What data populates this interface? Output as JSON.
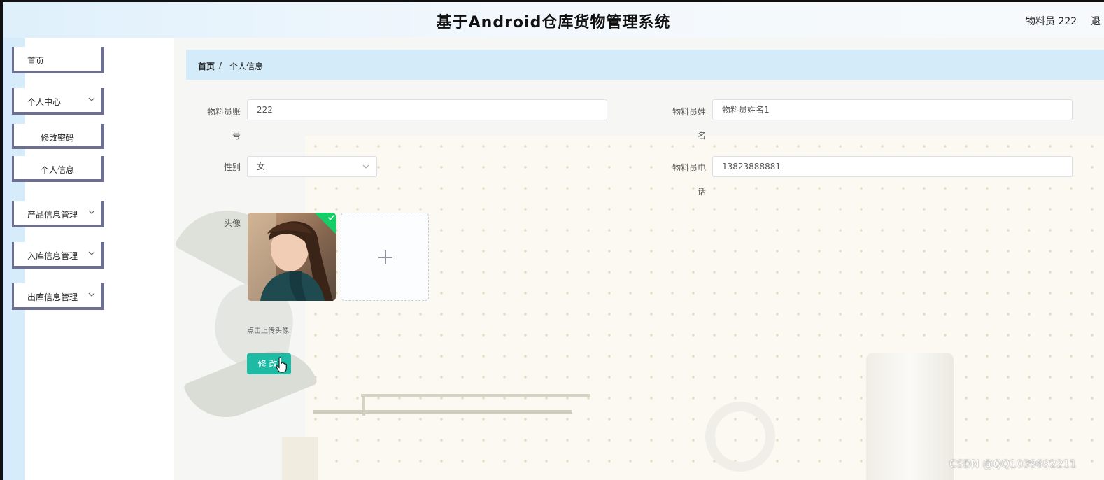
{
  "header": {
    "title": "基于Android仓库货物管理系统",
    "user": "物料员 222",
    "logout": "退"
  },
  "sidebar": {
    "items": [
      {
        "label": "首页",
        "has_arrow": false
      },
      {
        "label": "个人中心",
        "has_arrow": true
      },
      {
        "label": "修改密码",
        "has_arrow": false
      },
      {
        "label": "个人信息",
        "has_arrow": false
      },
      {
        "label": "产品信息管理",
        "has_arrow": true
      },
      {
        "label": "入库信息管理",
        "has_arrow": true
      },
      {
        "label": "出库信息管理",
        "has_arrow": true
      }
    ]
  },
  "breadcrumb": {
    "home": "首页",
    "separator": "/",
    "current": "个人信息"
  },
  "form": {
    "account_label": "物料员账号",
    "account_value": "222",
    "name_label": "物料员姓名",
    "name_value": "物料员姓名1",
    "gender_label": "性别",
    "gender_value": "女",
    "phone_label": "物料员电话",
    "phone_value": "13823888881",
    "avatar_label": "头像",
    "upload_tip": "点击上传头像",
    "submit_label": "修改"
  },
  "colors": {
    "accent": "#1ebba4",
    "sidebar_border": "#6c6f90",
    "breadcrumb_bg": "#d4ebf9",
    "success_check": "#13ce66"
  },
  "icons": {
    "menu_arrow": "chevron-down-icon",
    "select_arrow": "chevron-down-icon",
    "upload": "plus-icon",
    "uploaded": "check-icon",
    "cursor": "hand-pointer-icon"
  },
  "watermark": "CSDN @QQ1039692211"
}
